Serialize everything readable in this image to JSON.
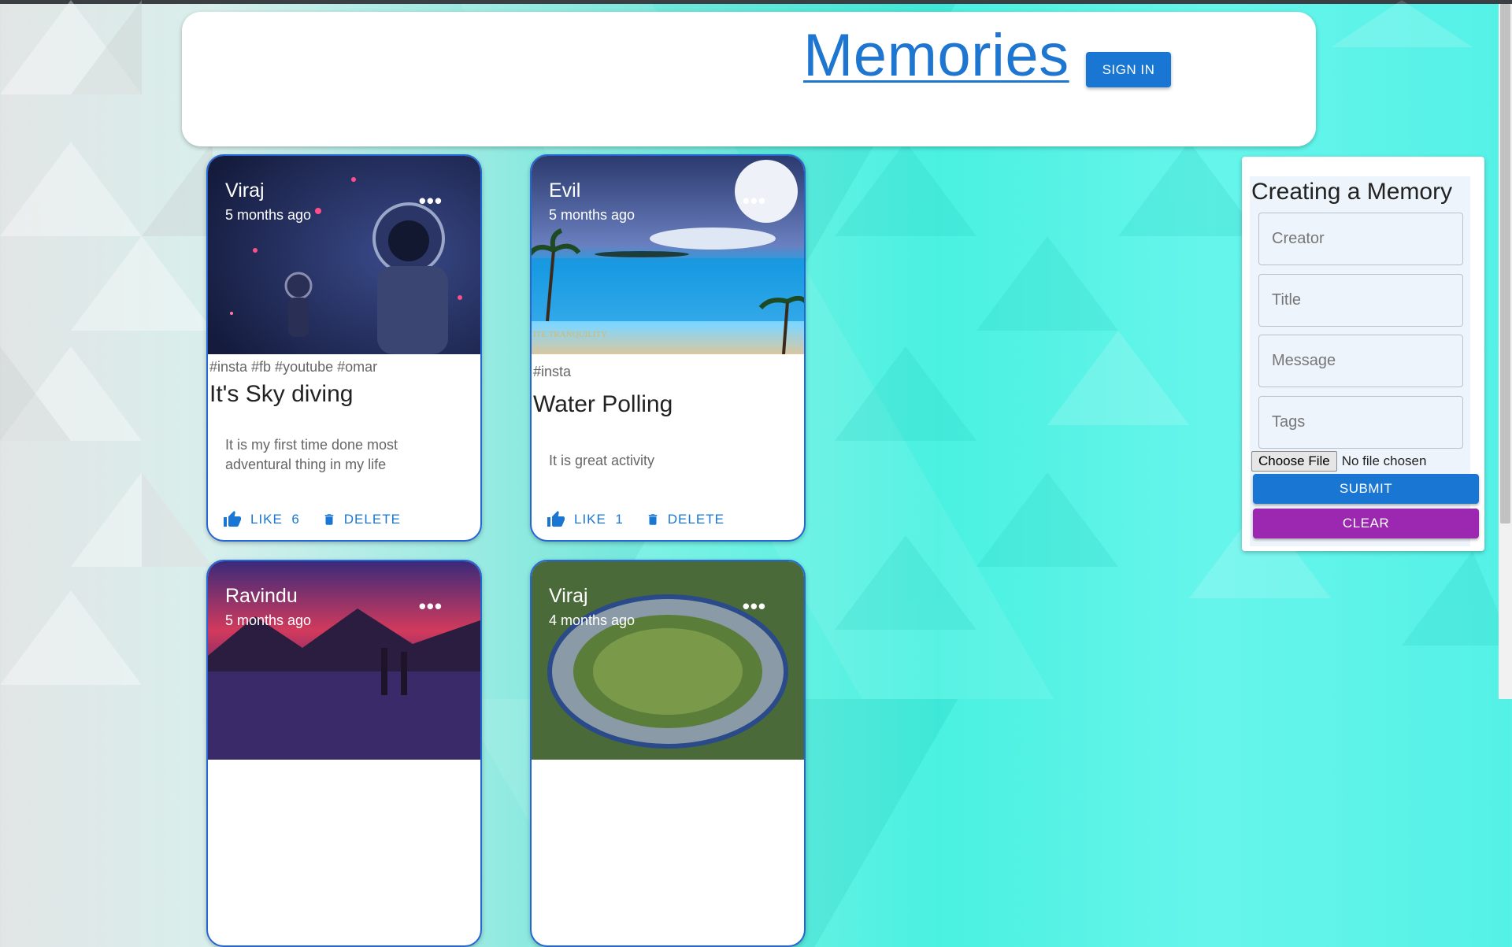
{
  "header": {
    "brand": "Memories",
    "signin_label": "SIGN IN"
  },
  "posts": [
    {
      "creator": "Viraj",
      "time": "5 months ago",
      "tags": "#insta #fb #youtube #omar",
      "title": "It's Sky diving",
      "message": "It is my first time done most adventural thing in my life",
      "like_label": "LIKE",
      "like_count": "6",
      "delete_label": "DELETE"
    },
    {
      "creator": "Evil",
      "time": "5 months ago",
      "tags": "#insta",
      "title": "Water Polling",
      "message": "It is great activity",
      "like_label": "LIKE",
      "like_count": "1",
      "delete_label": "DELETE",
      "image_caption": "ITE TRANQUILITY"
    },
    {
      "creator": "Ravindu",
      "time": "5 months ago"
    },
    {
      "creator": "Viraj",
      "time": "4 months ago"
    }
  ],
  "more_icon": "more-horiz-icon",
  "form": {
    "title": "Creating a Memory",
    "creator_placeholder": "Creator",
    "title_placeholder": "Title",
    "message_placeholder": "Message",
    "tags_placeholder": "Tags",
    "file_button": "Choose File",
    "file_status": "No file chosen",
    "submit_label": "SUBMIT",
    "clear_label": "CLEAR"
  },
  "colors": {
    "primary": "#1976d2",
    "secondary": "#9c27b0",
    "card_border": "#2566d6"
  }
}
